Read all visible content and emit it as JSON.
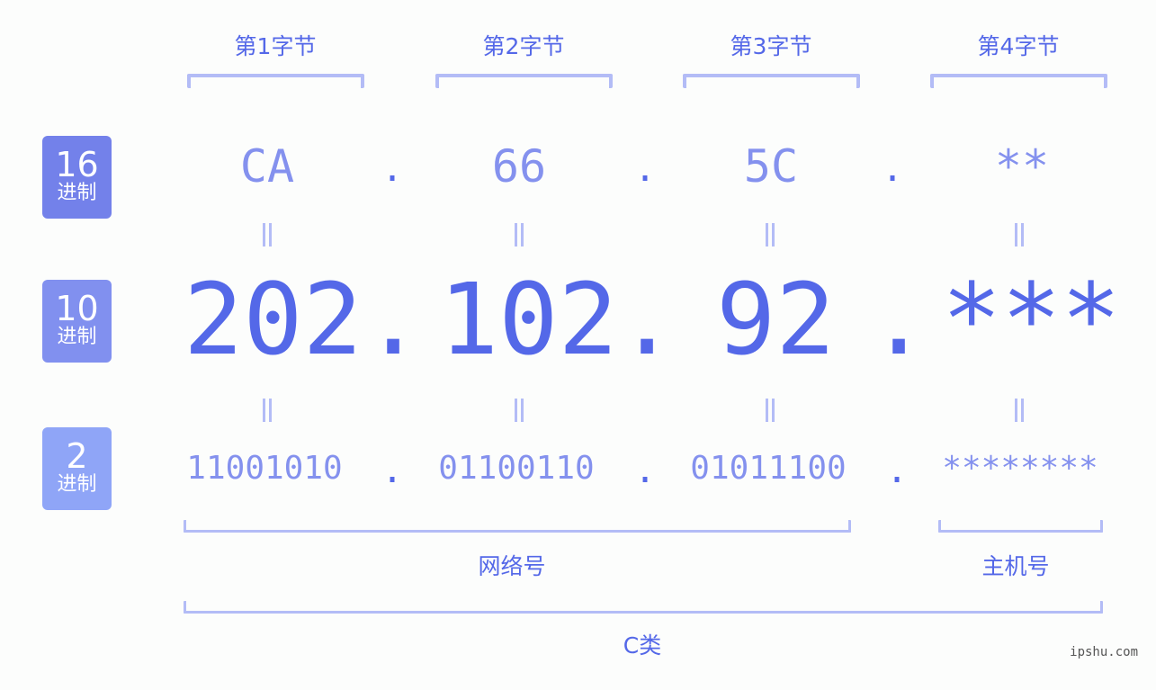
{
  "bytes": [
    {
      "label": "第1字节",
      "hex": "CA",
      "dec": "202",
      "bin": "11001010"
    },
    {
      "label": "第2字节",
      "hex": "66",
      "dec": "102",
      "bin": "01100110"
    },
    {
      "label": "第3字节",
      "hex": "5C",
      "dec": "92",
      "bin": "01011100"
    },
    {
      "label": "第4字节",
      "hex": "**",
      "dec": "***",
      "bin": "********"
    }
  ],
  "separator": ".",
  "equals_sign": "=",
  "badges": [
    {
      "num": "16",
      "unit": "进制",
      "color": "#7381ea"
    },
    {
      "num": "10",
      "unit": "进制",
      "color": "#8190ef"
    },
    {
      "num": "2",
      "unit": "进制",
      "color": "#8fa5f7"
    }
  ],
  "groups": {
    "network": "网络号",
    "host": "主机号",
    "class": "C类"
  },
  "watermark": "ipshu.com",
  "colors": {
    "accent": "#5468e8",
    "light": "#8491ee",
    "bracket": "#b3bcf6"
  }
}
